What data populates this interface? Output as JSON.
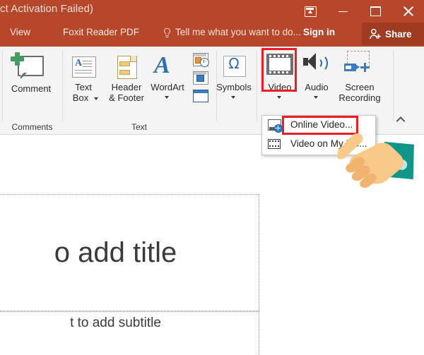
{
  "window": {
    "title": "ct Activation Failed)",
    "controls": {
      "ribbon_display": "ribbon-display-options-icon",
      "minimize": "minimize-icon",
      "maximize": "maximize-icon",
      "close": "close-icon"
    }
  },
  "tabs": [
    {
      "label": "View",
      "x": 14
    },
    {
      "label": "Foxit Reader PDF",
      "x": 89
    }
  ],
  "tellme": {
    "text": "Tell me what you want to do...",
    "icon": "lightbulb-icon"
  },
  "signin": {
    "label": "Sign in"
  },
  "share": {
    "label": "Share",
    "icon": "share-person-icon",
    "bg": "#9e3b21"
  },
  "ribbon": {
    "groups": [
      {
        "name": "Comments",
        "label": "Comments"
      },
      {
        "name": "Text",
        "label": "Text"
      }
    ],
    "buttons": {
      "comment": {
        "label": "Comment",
        "icon": "comment-add-icon"
      },
      "text_box": {
        "label": "Text",
        "label2": "Box",
        "icon": "text-box-icon",
        "has_caret": true
      },
      "header_footer": {
        "label": "Header",
        "label2": "& Footer",
        "icon": "header-footer-icon"
      },
      "wordart": {
        "label": "WordArt",
        "icon": "wordart-icon",
        "has_caret": true
      },
      "date_time": {
        "icon": "date-and-time-icon"
      },
      "slide_number": {
        "icon": "slide-number-icon"
      },
      "object": {
        "icon": "insert-object-icon"
      },
      "symbols": {
        "label": "Symbols",
        "icon": "omega-symbol-icon",
        "glyph": "Ω",
        "has_caret": true
      },
      "video": {
        "label": "Video",
        "icon": "video-film-icon",
        "has_caret": true,
        "highlighted": true
      },
      "audio": {
        "label": "Audio",
        "icon": "audio-speaker-icon",
        "has_caret": true
      },
      "screen_recording": {
        "label": "Screen",
        "label2": "Recording",
        "icon": "screen-recording-icon"
      }
    },
    "collapse": {
      "icon": "chevron-up-icon"
    }
  },
  "video_menu": {
    "items": [
      {
        "label": "Online Video...",
        "icon": "online-video-icon",
        "highlighted": true
      },
      {
        "label": "Video on My PC...",
        "icon": "video-file-icon",
        "highlighted": false
      }
    ]
  },
  "slide": {
    "title_placeholder": "o add title",
    "subtitle_placeholder": "t to add subtitle"
  },
  "colors": {
    "titlebar": "#b7472a",
    "share_bg": "#9e3b21",
    "ribbon_bg": "#f4f4f4",
    "highlight_red": "#ee1c25",
    "hand_skin": "#f9c98a",
    "hand_sleeve": "#0f9688"
  }
}
